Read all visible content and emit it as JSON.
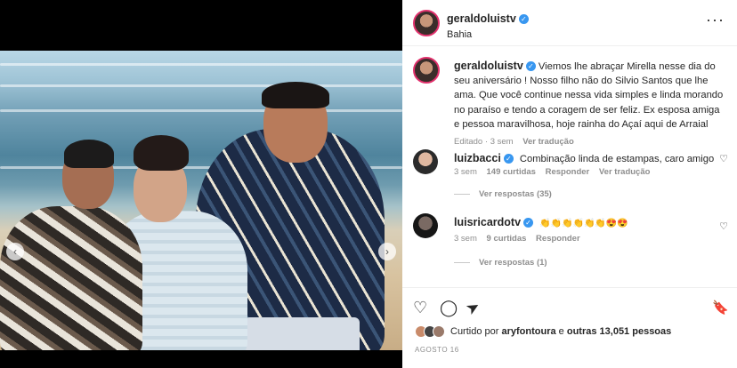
{
  "post": {
    "username": "geraldoluistv",
    "location": "Bahia",
    "more_icon": "···"
  },
  "caption": {
    "username": "geraldoluistv",
    "text": "Viemos lhe abraçar Mirella nesse dia do seu aniversário ! Nosso filho não do Silvio Santos que lhe ama. Que você continue nessa vida simples e linda morando no paraíso e tendo a coragem de ser feliz. Ex esposa amiga e pessoa maravilhosa, hoje rainha do Açaí aqui de Arraial",
    "edited": "Editado",
    "time": "3 sem",
    "translate": "Ver tradução"
  },
  "comments": [
    {
      "username": "luizbacci",
      "text": "Combinação linda de estampas, caro amigo",
      "time": "3 sem",
      "likes": "149 curtidas",
      "reply": "Responder",
      "translate": "Ver tradução",
      "view_replies": "Ver respostas (35)"
    },
    {
      "username": "luisricardotv",
      "text": "👏👏👏👏👏👏😍😍",
      "time": "3 sem",
      "likes": "9 curtidas",
      "reply": "Responder",
      "view_replies": "Ver respostas (1)"
    }
  ],
  "liked_by": {
    "prefix": "Curtido por",
    "user": "aryfontoura",
    "connector": "e",
    "others": "outras 13,051 pessoas"
  },
  "date": "AGOSTO 16",
  "icons": {
    "heart": "♡",
    "comment": "◯",
    "share": "➤",
    "bookmark": "🔖",
    "prev": "‹",
    "next": "›",
    "verified": "✓"
  },
  "colors": {
    "verified": "#3897f0",
    "muted": "#8e8e8e",
    "text": "#262626"
  }
}
